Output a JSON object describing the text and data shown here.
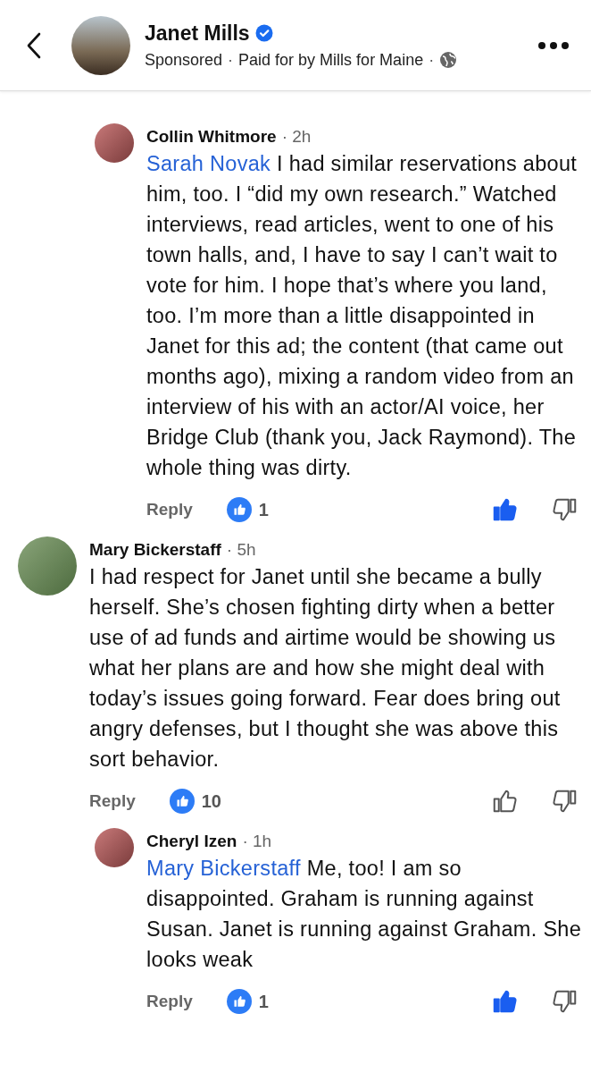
{
  "header": {
    "name": "Janet Mills",
    "verified": true,
    "sponsored": "Sponsored",
    "paid_for": "Paid for by Mills for Maine",
    "separator": "·"
  },
  "replies_above": [
    {
      "author": "Collin Whitmore",
      "time": "2h",
      "mention": "Sarah Novak",
      "text": " I had similar reservations about him, too. I “did my own research.” Watched interviews, read articles, went to one of his town halls, and, I have to say I can’t wait to vote for him. I hope that’s where you land, too.  I’m more than a little disappointed in Janet for this ad; the content (that came out months ago), mixing a random video from an interview of his with an actor/AI voice, her Bridge Club (thank you, Jack Raymond). The whole thing was dirty.",
      "reply": "Reply",
      "likes": "1",
      "liked": true
    }
  ],
  "comments": [
    {
      "author": "Mary Bickerstaff",
      "time": "5h",
      "text": "I had respect for Janet until she became a bully herself. She’s chosen fighting dirty when a better use of ad funds and airtime would be showing us what her plans are and how she might deal with today’s issues going forward. Fear does bring out angry defenses, but I thought she was above this sort behavior.",
      "reply": "Reply",
      "likes": "10",
      "liked": false,
      "replies": [
        {
          "author": "Cheryl Izen",
          "time": "1h",
          "mention": "Mary Bickerstaff",
          "text": " Me, too! I am so disappointed. Graham is running against Susan. Janet is running against Graham. She looks weak",
          "reply": "Reply",
          "likes": "1",
          "liked": true
        }
      ]
    }
  ]
}
